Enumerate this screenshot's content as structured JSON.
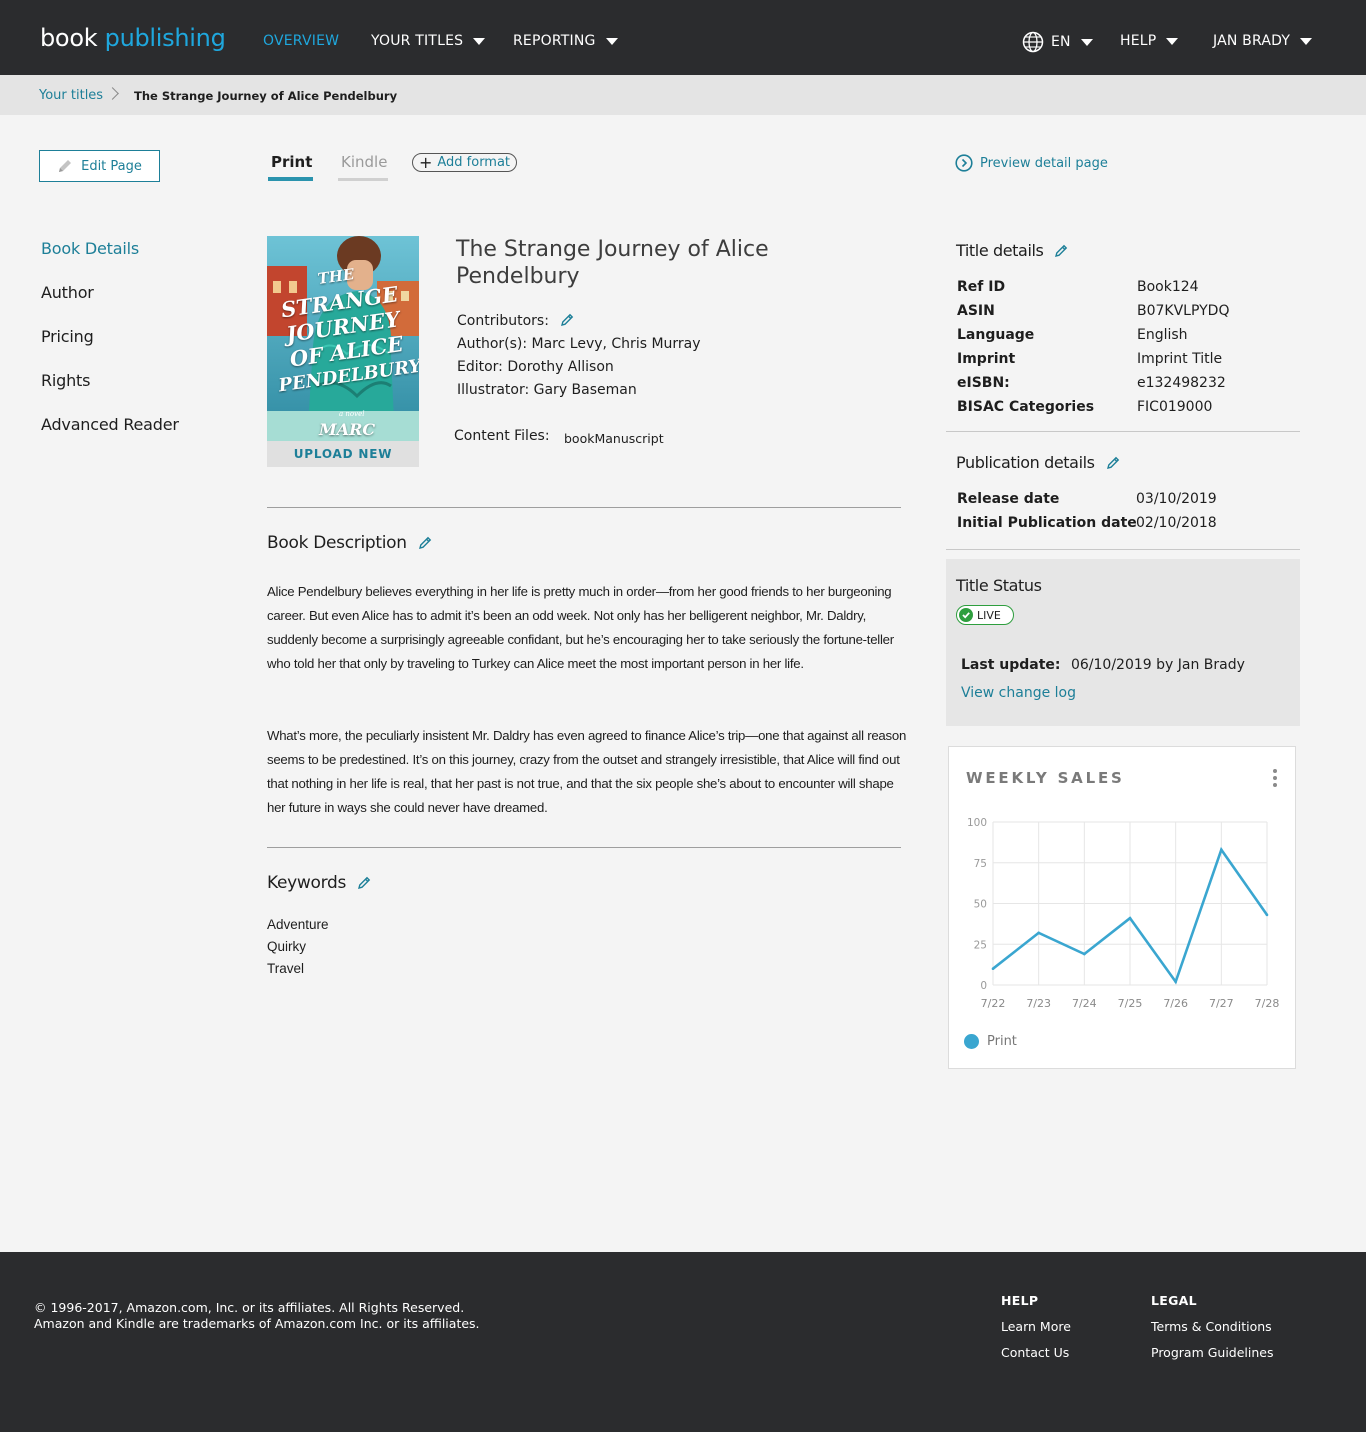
{
  "header": {
    "logo_part1": "book",
    "logo_part2": "publishing",
    "nav": {
      "overview": "OVERVIEW",
      "your_titles": "YOUR TITLES",
      "reporting": "REPORTING",
      "language": "EN",
      "help": "HELP",
      "user": "JAN BRADY"
    },
    "accent_color": "#1fa7dd"
  },
  "breadcrumb": {
    "link": "Your titles",
    "current": "The Strange Journey of Alice Pendelbury"
  },
  "toolbar": {
    "edit_page": "Edit Page",
    "tabs": [
      "Print",
      "Kindle"
    ],
    "active_tab": "Print",
    "add_format": "Add format",
    "preview": "Preview detail page"
  },
  "sidebar": {
    "items": [
      "Book Details",
      "Author",
      "Pricing",
      "Rights",
      "Advanced Reader"
    ],
    "active": "Book Details"
  },
  "book": {
    "title": "The Strange Journey of Alice Pendelbury",
    "cover_text": [
      "THE",
      "STRANGE",
      "JOURNEY",
      "OF ALICE",
      "PENDELBURY",
      "a novel",
      "MARC LEVY"
    ],
    "upload_label": "UPLOAD NEW",
    "contributors_label": "Contributors:",
    "authors": "Author(s): Marc Levy, Chris Murray",
    "editor": "Editor: Dorothy Allison",
    "illustrator": "Illustrator: Gary Baseman",
    "content_files_label": "Content Files:",
    "content_files_value": "bookManuscript"
  },
  "description": {
    "title": "Book Description",
    "paragraph1": "Alice Pendelbury believes everything in her life is pretty much in order—from her good friends to her burgeoning career. But even Alice has to admit it’s been an odd week. Not only has her belligerent neighbor, Mr. Daldry, suddenly become a surprisingly agreeable confidant, but he’s encouraging her to take seriously the fortune-teller who told her that only by traveling to Turkey can Alice meet the most important person in her life.",
    "paragraph2": "What’s more, the peculiarly insistent Mr. Daldry has even agreed to finance Alice’s trip—one that against all reason seems to be predestined. It’s on this journey, crazy from the outset and strangely irresistible, that Alice will find out that nothing in her life is real, that her past is not true, and that the six people she’s about to encounter will shape her future in ways she could never have dreamed."
  },
  "keywords": {
    "title": "Keywords",
    "items": [
      "Adventure",
      "Quirky",
      "Travel"
    ]
  },
  "title_details": {
    "title": "Title details",
    "rows": [
      {
        "label": "Ref ID",
        "value": "Book124"
      },
      {
        "label": "ASIN",
        "value": "B07KVLPYDQ"
      },
      {
        "label": "Language",
        "value": "English"
      },
      {
        "label": "Imprint",
        "value": "Imprint Title"
      },
      {
        "label": "eISBN:",
        "value": "e132498232"
      },
      {
        "label": "BISAC Categories",
        "value": "FIC019000"
      }
    ]
  },
  "publication_details": {
    "title": "Publication details",
    "rows": [
      {
        "label": "Release date",
        "value": "03/10/2019"
      },
      {
        "label": "Initial Publication date",
        "value": "02/10/2018"
      }
    ]
  },
  "title_status": {
    "title": "Title Status",
    "badge": "LIVE",
    "last_update_label": "Last update:",
    "last_update_value": "06/10/2019 by Jan Brady",
    "change_log": "View change log",
    "status_color": "#2e9e3e"
  },
  "weekly_sales": {
    "title": "WEEKLY SALES",
    "legend": "Print",
    "series_color": "#3aa6d0"
  },
  "chart_data": {
    "type": "line",
    "title": "WEEKLY SALES",
    "categories": [
      "7/22",
      "7/23",
      "7/24",
      "7/25",
      "7/26",
      "7/27",
      "7/28"
    ],
    "series": [
      {
        "name": "Print",
        "values": [
          10,
          32,
          19,
          41,
          2,
          83,
          43
        ]
      }
    ],
    "yticks": [
      0,
      25,
      50,
      75,
      100
    ],
    "ylim": [
      0,
      100
    ],
    "grid": true,
    "legend_position": "bottom-left"
  },
  "footer": {
    "copyright1": "© 1996-2017, Amazon.com, Inc. or its affiliates. All Rights Reserved.",
    "copyright2": "Amazon and Kindle are trademarks of Amazon.com Inc. or its affiliates.",
    "help_title": "HELP",
    "help_links": [
      "Learn More",
      "Contact Us"
    ],
    "legal_title": "LEGAL",
    "legal_links": [
      "Terms & Conditions",
      "Program Guidelines"
    ]
  }
}
